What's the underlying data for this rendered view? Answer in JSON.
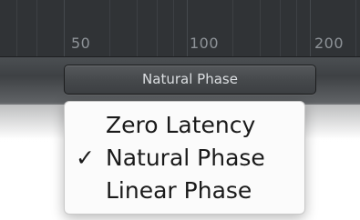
{
  "frequency_scale": {
    "labels": [
      "50",
      "100",
      "200"
    ]
  },
  "mode_button": {
    "label": "Natural Phase"
  },
  "mode_menu": {
    "items": [
      {
        "label": "Zero Latency",
        "checked": false
      },
      {
        "label": "Natural Phase",
        "checked": true
      },
      {
        "label": "Linear Phase",
        "checked": false
      }
    ],
    "check_glyph": "✓"
  }
}
